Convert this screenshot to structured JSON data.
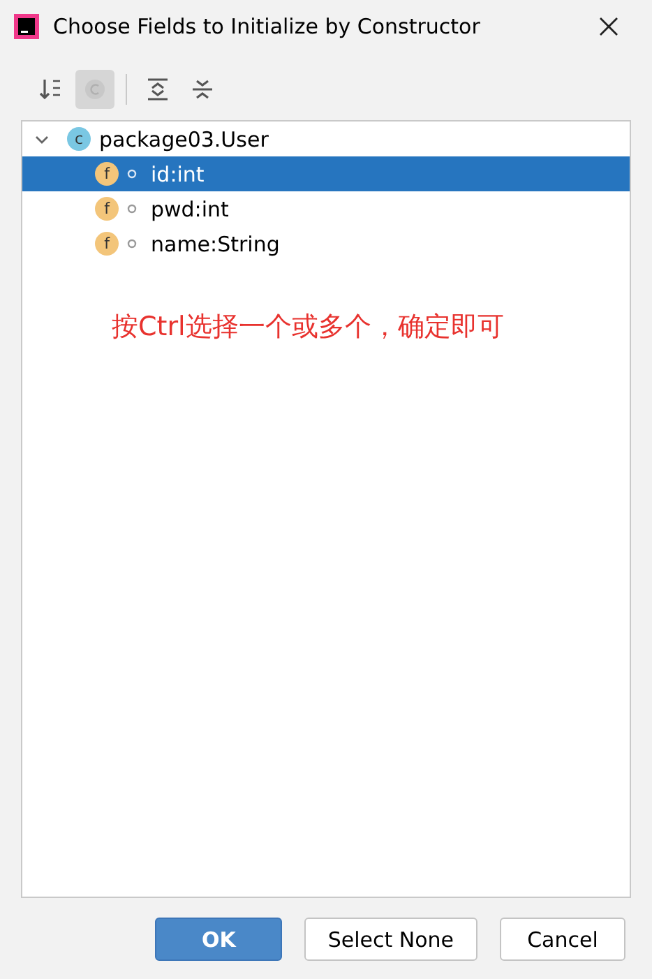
{
  "window": {
    "title": "Choose Fields to Initialize by Constructor"
  },
  "toolbar": [
    {
      "kind": "sort",
      "selected": false
    },
    {
      "kind": "class",
      "selected": true
    },
    {
      "kind": "expand",
      "selected": false
    },
    {
      "kind": "collapse",
      "selected": false
    }
  ],
  "tree": {
    "label": "package03.User",
    "badge": "c",
    "expanded": true,
    "children": [
      {
        "label": "id:int",
        "badge": "f",
        "selected": true
      },
      {
        "label": "pwd:int",
        "badge": "f",
        "selected": false
      },
      {
        "label": "name:String",
        "badge": "f",
        "selected": false
      }
    ]
  },
  "annotation": "按Ctrl选择一个或多个，确定即可",
  "buttons": [
    {
      "label": "OK",
      "primary": true
    },
    {
      "label": "Select None",
      "primary": false
    },
    {
      "label": "Cancel",
      "primary": false
    }
  ]
}
